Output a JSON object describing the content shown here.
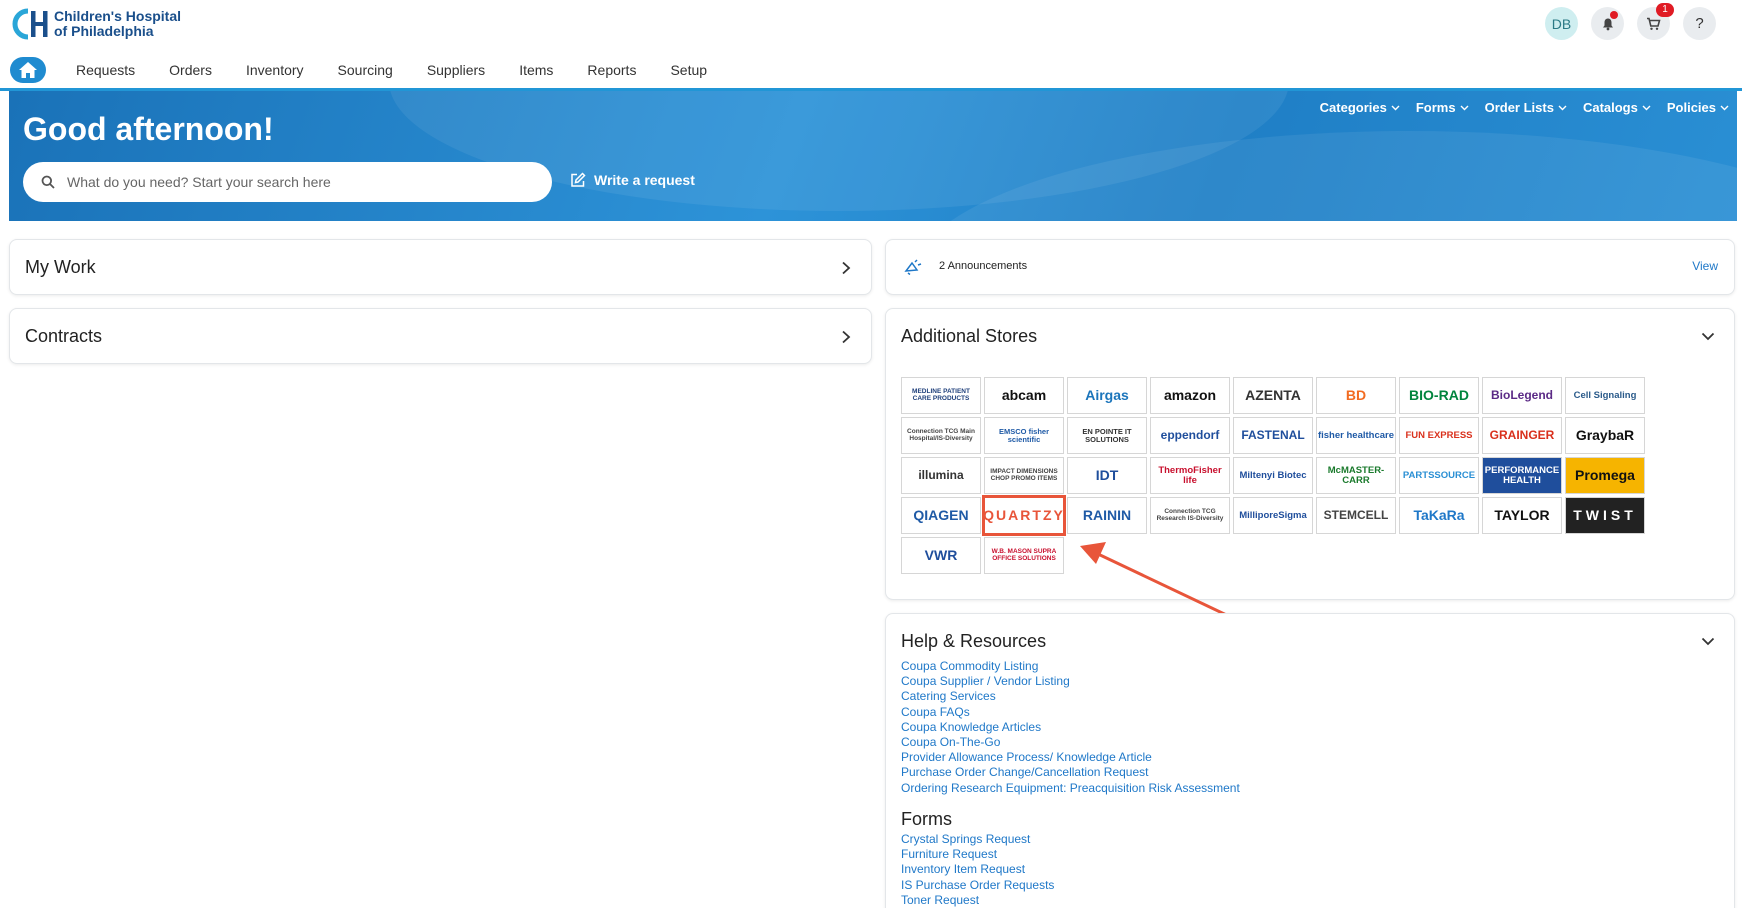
{
  "brand": {
    "name_line1": "Children's Hospital",
    "name_line2": "of Philadelphia",
    "accent": "#2196d6"
  },
  "user": {
    "initials": "DB",
    "cart_count": "1"
  },
  "nav": [
    "Requests",
    "Orders",
    "Inventory",
    "Sourcing",
    "Suppliers",
    "Items",
    "Reports",
    "Setup"
  ],
  "banner": {
    "greeting": "Good afternoon!",
    "search_placeholder": "What do you need? Start your search here",
    "write_request": "Write a request",
    "menu": [
      "Categories",
      "Forms",
      "Order Lists",
      "Catalogs",
      "Policies"
    ]
  },
  "my_work": {
    "title": "My Work"
  },
  "contracts": {
    "title": "Contracts"
  },
  "announcements": {
    "text": "2 Announcements",
    "view": "View"
  },
  "stores": {
    "title": "Additional Stores",
    "items": [
      {
        "label": "MEDLINE PATIENT CARE PRODUCTS",
        "color": "#1d3e7a"
      },
      {
        "label": "abcam",
        "color": "#111111"
      },
      {
        "label": "Airgas",
        "color": "#1b75bb"
      },
      {
        "label": "amazon",
        "color": "#111111"
      },
      {
        "label": "AZENTA",
        "color": "#333333"
      },
      {
        "label": "BD",
        "color": "#f26b21"
      },
      {
        "label": "BIO-RAD",
        "color": "#00843d"
      },
      {
        "label": "BioLegend",
        "color": "#5b2a86"
      },
      {
        "label": "Cell Signaling",
        "color": "#2a5a8a"
      },
      {
        "label": "Connection TCG Main Hospital/IS-Diversity",
        "color": "#444444"
      },
      {
        "label": "EMSCO fisher scientific",
        "color": "#1f5aa6"
      },
      {
        "label": "EN POINTE IT SOLUTIONS",
        "color": "#333333"
      },
      {
        "label": "eppendorf",
        "color": "#1f4e9c"
      },
      {
        "label": "FASTENAL",
        "color": "#1f4e9c"
      },
      {
        "label": "fisher healthcare",
        "color": "#1f5aa6"
      },
      {
        "label": "FUN EXPRESS",
        "color": "#d9301c"
      },
      {
        "label": "GRAINGER",
        "color": "#d9301c"
      },
      {
        "label": "GraybaR",
        "color": "#111111"
      },
      {
        "label": "illumina",
        "color": "#333333"
      },
      {
        "label": "IMPACT DIMENSIONS CHOP PROMO ITEMS",
        "color": "#444444"
      },
      {
        "label": "IDT",
        "color": "#1f4e9c"
      },
      {
        "label": "ThermoFisher life",
        "color": "#c8102e"
      },
      {
        "label": "Miltenyi Biotec",
        "color": "#1f4e9c"
      },
      {
        "label": "McMASTER-CARR",
        "color": "#1a7a2c"
      },
      {
        "label": "PARTSSOURCE",
        "color": "#2a8fd4"
      },
      {
        "label": "PERFORMANCE HEALTH",
        "color": "#ffffff"
      },
      {
        "label": "Promega",
        "color": "#111111"
      },
      {
        "label": "QIAGEN",
        "color": "#1f5aa6"
      },
      {
        "label": "QUARTZY",
        "color": "#e8553a"
      },
      {
        "label": "RAININ",
        "color": "#1f5aa6"
      },
      {
        "label": "Connection TCG Research IS-Diversity",
        "color": "#444444"
      },
      {
        "label": "MilliporeSigma",
        "color": "#1f4e9c"
      },
      {
        "label": "STEMCELL",
        "color": "#444444"
      },
      {
        "label": "TaKaRa",
        "color": "#1f78c8"
      },
      {
        "label": "TAYLOR",
        "color": "#111111"
      },
      {
        "label": "TWIST",
        "color": "#ffffff"
      },
      {
        "label": "VWR",
        "color": "#1f4e9c"
      },
      {
        "label": "W.B. MASON SUPRA OFFICE SOLUTIONS",
        "color": "#c8102e"
      }
    ]
  },
  "help": {
    "title": "Help & Resources",
    "links": [
      "Coupa Commodity Listing",
      "Coupa Supplier / Vendor Listing",
      "Catering Services",
      "Coupa FAQs",
      "Coupa Knowledge Articles",
      "Coupa On-The-Go",
      "Provider Allowance Process/ Knowledge Article",
      "Purchase Order Change/Cancellation Request",
      "Ordering Research Equipment: Preacquisition Risk Assessment"
    ]
  },
  "forms": {
    "title": "Forms",
    "links": [
      "Crystal Springs Request",
      "Furniture Request",
      "Inventory Item Request",
      "IS Purchase Order Requests",
      "Toner Request"
    ]
  }
}
